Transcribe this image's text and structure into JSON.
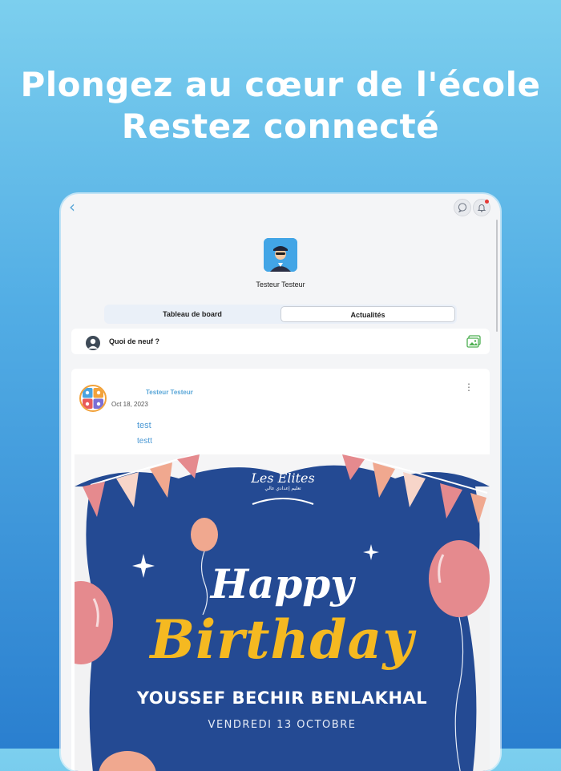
{
  "headline": {
    "line1": "Plongez au cœur de l'école",
    "line2": "Restez connecté"
  },
  "topbar": {
    "back_icon": "chevron-left-icon",
    "chat_icon": "chat-bubble-icon",
    "bell_icon": "bell-icon",
    "has_notification": true
  },
  "profile": {
    "name": "Testeur Testeur"
  },
  "tabs": [
    {
      "label": "Tableau de board",
      "active": false
    },
    {
      "label": "Actualités",
      "active": true
    }
  ],
  "composer": {
    "prompt": "Quoi de neuf ?"
  },
  "post": {
    "author": "Testeur Testeur",
    "date": "Oct 18, 2023",
    "text_lines": [
      "test",
      "testt"
    ],
    "banner": {
      "brand": "Les Elites",
      "brand_subtitle": "تعليم إعدادي عالي",
      "happy": "Happy",
      "birthday": "Birthday",
      "name": "YOUSSEF BECHIR BENLAKHAL",
      "date": "VENDREDI 13 OCTOBRE"
    }
  },
  "colors": {
    "accent": "#5aa7d8",
    "banner_blue": "#234a93",
    "birthday_gold": "#f5b921",
    "balloon_pink": "#e58a8e"
  }
}
